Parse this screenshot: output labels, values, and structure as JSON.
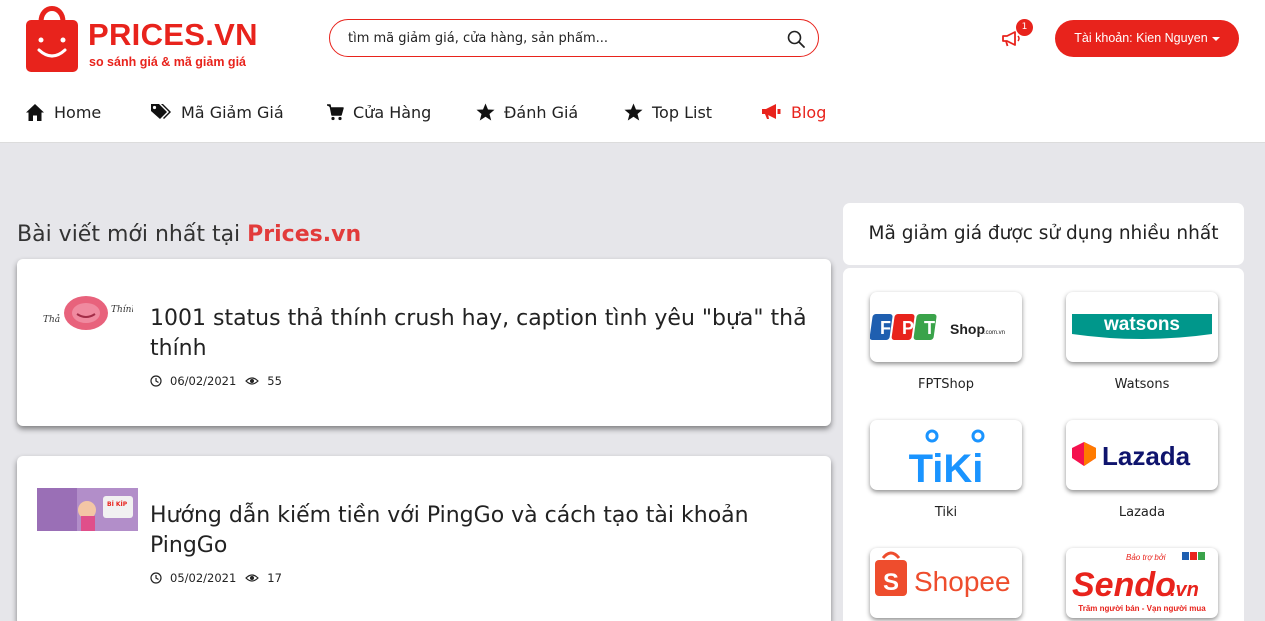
{
  "header": {
    "logo_title": "PRICES.VN",
    "logo_subtitle": "so sánh giá & mã giảm giá",
    "search_placeholder": "tìm mã giảm giá, cửa hàng, sản phẩm...",
    "notification_count": "1",
    "account_label": "Tài khoản: Kien Nguyen"
  },
  "nav": {
    "items": [
      {
        "label": "Home",
        "icon": "home-icon"
      },
      {
        "label": "Mã Giảm Giá",
        "icon": "tags-icon"
      },
      {
        "label": "Cửa Hàng",
        "icon": "cart-icon"
      },
      {
        "label": "Đánh Giá",
        "icon": "star-icon"
      },
      {
        "label": "Top List",
        "icon": "star-icon"
      },
      {
        "label": "Blog",
        "icon": "megaphone-icon",
        "active": true
      }
    ]
  },
  "main": {
    "section_title_prefix": "Bài viết mới nhất tại",
    "section_title_brand": "Prices.vn",
    "articles": [
      {
        "title": "1001 status thả thính crush hay, caption tình yêu \"bựa\" thả thính",
        "date": "06/02/2021",
        "views": "55",
        "thumb_caption_left": "Thả",
        "thumb_caption_right": "Thính"
      },
      {
        "title": "Hướng dẫn kiếm tiền với PingGo và cách tạo tài khoản PingGo",
        "date": "05/02/2021",
        "views": "17",
        "thumb_caption": "BÍ KÍP"
      }
    ]
  },
  "sidebar": {
    "title": "Mã giảm giá được sử dụng nhiều nhất",
    "stores": [
      {
        "name": "FPTShop",
        "logo_text": "Shop"
      },
      {
        "name": "Watsons",
        "logo_text": "watsons"
      },
      {
        "name": "Tiki",
        "logo_text": "TiKi"
      },
      {
        "name": "Lazada",
        "logo_text": "Lazada"
      },
      {
        "name": "",
        "logo_text": "Shopee"
      },
      {
        "name": "",
        "logo_text": "Sendo",
        "logo_text_suffix": ".vn",
        "logo_tagline": "Trăm người bán - Vạn người mua",
        "logo_sponsor": "Bảo trợ bởi"
      }
    ]
  },
  "colors": {
    "brand_red": "#e8231c",
    "background": "#e6e6ea"
  }
}
